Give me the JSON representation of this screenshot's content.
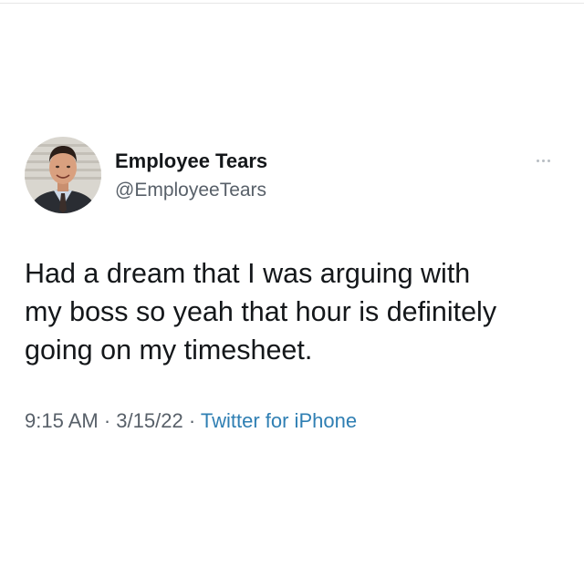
{
  "tweet": {
    "author": {
      "display_name": "Employee Tears",
      "handle": "@EmployeeTears",
      "avatar_icon": "profile-photo"
    },
    "more_icon": "more-horizontal-icon",
    "text_lines": [
      "Had a dream that I was arguing with",
      "my boss so yeah that hour is definitely",
      "going on my timesheet."
    ],
    "time": "9:15 AM",
    "separator": "·",
    "date": "3/15/22",
    "source": "Twitter for iPhone"
  },
  "colors": {
    "text": "#14171a",
    "secondary": "#586069",
    "link": "#2f7fb3",
    "background": "#ffffff"
  }
}
